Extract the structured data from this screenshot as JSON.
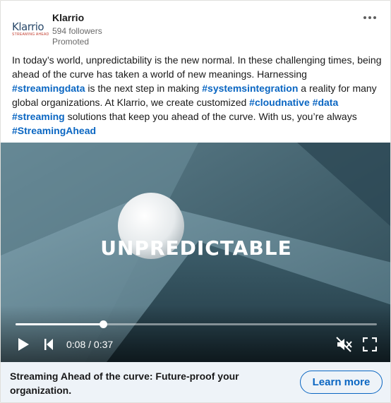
{
  "company": {
    "name": "Klarrio",
    "followers": "594 followers",
    "promoted": "Promoted",
    "logo_word": "Klarrio",
    "logo_tagline": "STREAMING AHEAD"
  },
  "post": {
    "t1": "In today’s world, unpredictability is the new normal. In these challenging times, being ahead of the curve has taken a world of new meanings. Harnessing ",
    "h1": "#streamingdata",
    "t2": " is the next step in making ",
    "h2": "#systemsintegration",
    "t3": " a reality for many global organizations. At Klarrio, we create customized ",
    "h3": "#cloudnative",
    "t4": " ",
    "h4": "#data",
    "t5": " ",
    "h5": "#streaming",
    "t6": " solutions that keep you ahead of the curve. With us, you’re always ",
    "h6": "#StreamingAhead"
  },
  "video": {
    "overlay_text": "UNPREDICTABLE",
    "time": "0:08 / 0:37",
    "progress_fraction": 0.2424
  },
  "cta": {
    "headline": "Streaming Ahead of the curve: Future-proof your organization.",
    "button_label": "Learn more"
  },
  "colors": {
    "accent": "#0a66c2",
    "cta_background": "#eef3f8"
  },
  "icons": {
    "more": "more-horizontal-icon",
    "play": "play-icon",
    "restart": "skip-back-icon",
    "mute": "volume-muted-icon",
    "fullscreen": "fullscreen-icon"
  }
}
